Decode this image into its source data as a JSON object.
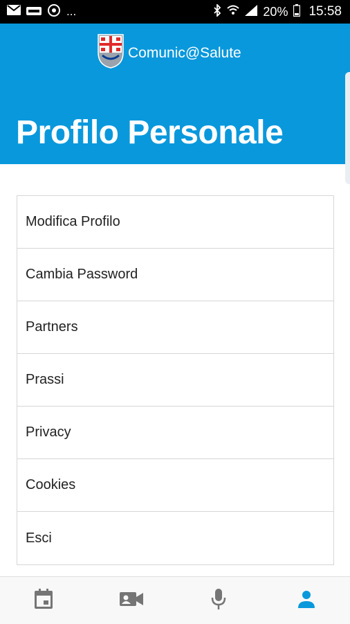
{
  "status_bar": {
    "time": "15:58",
    "battery": "20%",
    "more": "..."
  },
  "header": {
    "brand_name": "Comunic@Salute",
    "page_title": "Profilo Personale",
    "colors": {
      "primary": "#0998dc",
      "inactive_icon": "#757575",
      "active_icon": "#0998dc"
    }
  },
  "menu": {
    "items": [
      {
        "label": "Modifica Profilo"
      },
      {
        "label": "Cambia Password"
      },
      {
        "label": "Partners"
      },
      {
        "label": "Prassi"
      },
      {
        "label": "Privacy"
      },
      {
        "label": "Cookies"
      },
      {
        "label": "Esci"
      }
    ]
  },
  "tab_bar": {
    "tabs": [
      {
        "icon": "calendar-icon",
        "active": false
      },
      {
        "icon": "video-camera-icon",
        "active": false
      },
      {
        "icon": "microphone-icon",
        "active": false
      },
      {
        "icon": "person-icon",
        "active": true
      }
    ]
  }
}
